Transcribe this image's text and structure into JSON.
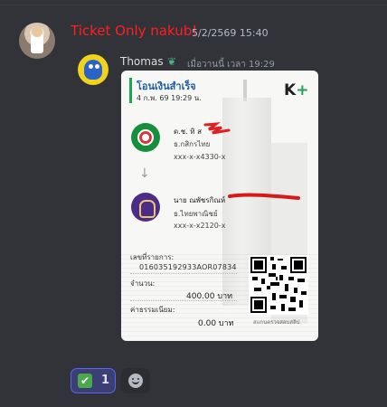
{
  "message": {
    "username": "Ticket Only nakub!",
    "timestamp": "5/2/2569 15:40",
    "username_color": "#ff1f1f"
  },
  "reply": {
    "name": "Thomas",
    "badge_icon": "leaf-badge-icon",
    "time": "เมื่อวานนี้ เวลา 19:29"
  },
  "slip": {
    "title": "โอนเงินสำเร็จ",
    "date": "4 ก.พ. 69  19:29 น.",
    "brand": "K",
    "brand_plus": "+",
    "from": {
      "name": "ด.ช. ทิ  ส",
      "bank": "ธ.กสิกรไทย",
      "account": "xxx-x-x4330-x"
    },
    "to": {
      "name": "นาย ณพัชรกิณห์",
      "bank": "ธ.ไทยพาณิชย์",
      "account": "xxx-x-x2120-x"
    },
    "ref_label": "เลขที่รายการ:",
    "ref_value": "016035192933AOR07834",
    "amount_label": "จำนวน:",
    "amount_value": "400.00 บาท",
    "fee_label": "ค่าธรรมเนียม:",
    "fee_value": "0.00 บาท",
    "qr_caption": "สแกนตรวจสอบสลิป"
  },
  "reactions": {
    "chip_emoji": "✔",
    "chip_count": "1",
    "add_icon": "smiley-icon"
  },
  "colors": {
    "background": "#313338",
    "accent": "#5865f2",
    "kbank_green": "#1ba84f",
    "scb_purple": "#4d2c87"
  }
}
